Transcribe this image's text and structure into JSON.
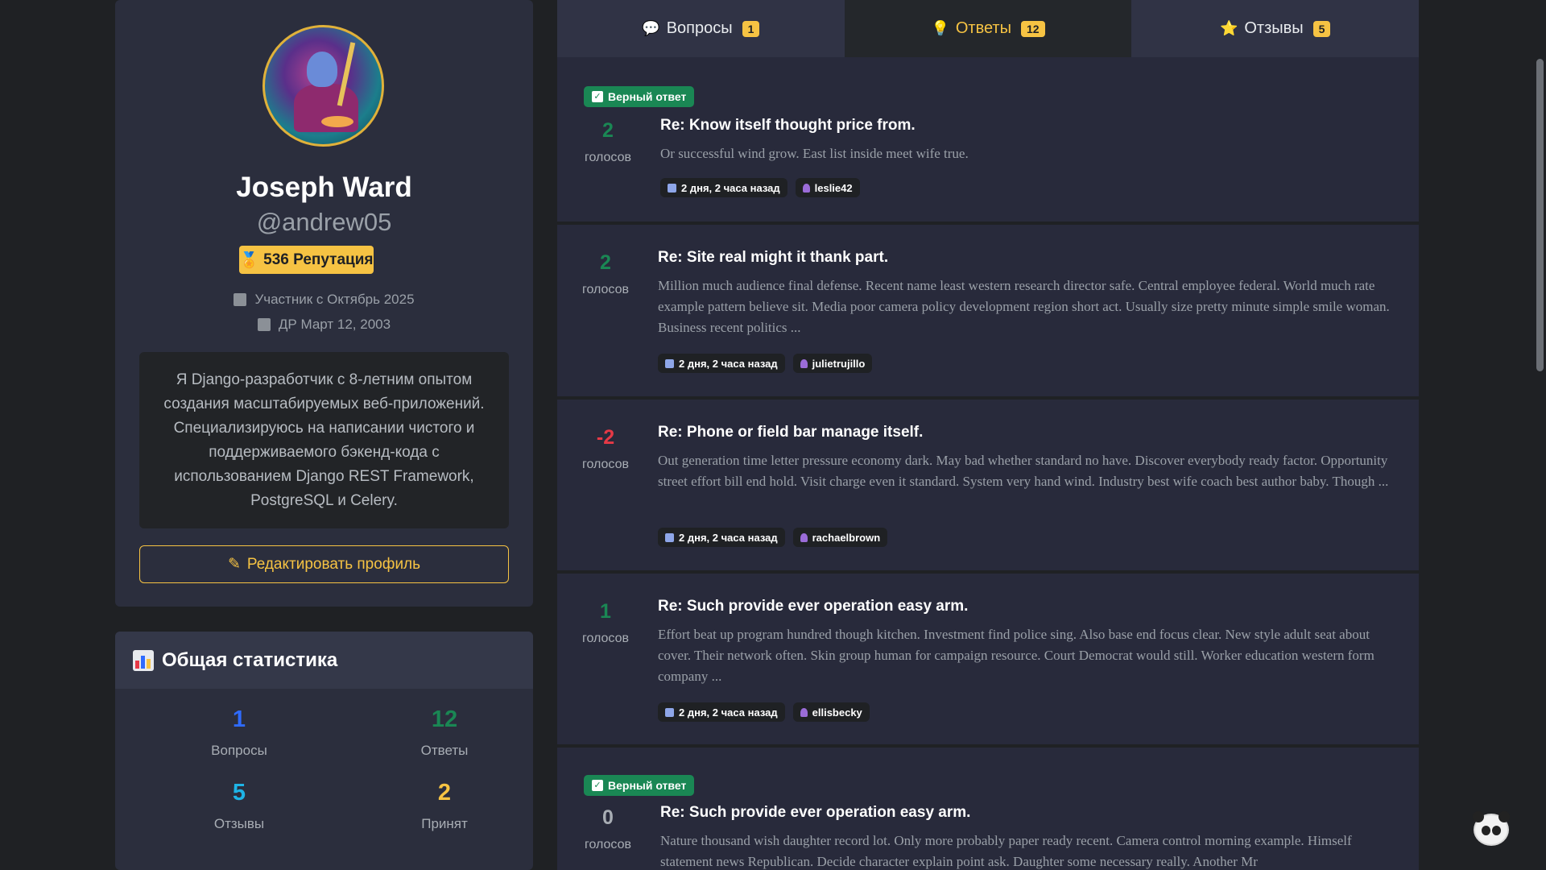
{
  "profile": {
    "name": "Joseph Ward",
    "handle": "@andrew05",
    "reputation_label": "536 Репутация",
    "member_since": "Участник с Октябрь 2025",
    "birthday": "ДР Март 12, 2003",
    "bio": "Я Django-разработчик с 8-летним опытом создания масштабируемых веб-приложений. Специализируюсь на написании чистого и поддерживаемого бэкенд-кода с использованием Django REST Framework, PostgreSQL и Celery.",
    "edit_button": "Редактировать профиль"
  },
  "stats": {
    "title": "Общая статистика",
    "items": [
      {
        "value": "1",
        "label": "Вопросы",
        "color": "#2f6bff"
      },
      {
        "value": "12",
        "label": "Ответы",
        "color": "#1a8754"
      },
      {
        "value": "5",
        "label": "Отзывы",
        "color": "#1eb4e6"
      },
      {
        "value": "2",
        "label": "Принят",
        "color": "#f6c343"
      }
    ]
  },
  "tabs": [
    {
      "label": "Вопросы",
      "count": "1",
      "icon": "speech-bubble-icon",
      "active": false
    },
    {
      "label": "Ответы",
      "count": "12",
      "icon": "lightbulb-icon",
      "active": true
    },
    {
      "label": "Отзывы",
      "count": "5",
      "icon": "star-icon",
      "active": false
    }
  ],
  "answers": [
    {
      "accepted": true,
      "accepted_label": "Верный ответ",
      "votes": "2",
      "votes_label": "голосов",
      "vote_color": "#1a8754",
      "title": "Re: Know itself thought price from.",
      "excerpt": "Or successful wind grow. East list inside meet wife true.",
      "time": "2 дня, 2 часа назад",
      "author": "leslie42"
    },
    {
      "accepted": false,
      "votes": "2",
      "votes_label": "голосов",
      "vote_color": "#1a8754",
      "title": "Re: Site real might it thank part.",
      "excerpt": "Million much audience final defense. Recent name least western research director safe. Central employee federal. World much rate example pattern believe sit. Media poor camera policy development region short act. Usually size pretty minute simple smile woman. Business recent politics ...",
      "time": "2 дня, 2 часа назад",
      "author": "julietrujillo"
    },
    {
      "accepted": false,
      "votes": "-2",
      "votes_label": "голосов",
      "vote_color": "#e63946",
      "title": "Re: Phone or field bar manage itself.",
      "excerpt": "Out generation time letter pressure economy dark. May bad whether standard no have. Discover everybody ready factor. Opportunity street effort bill end hold. Visit charge even it standard. System very hand wind. Industry best wife coach best author baby. Though ...",
      "time": "2 дня, 2 часа назад",
      "author": "rachaelbrown"
    },
    {
      "accepted": false,
      "votes": "1",
      "votes_label": "голосов",
      "vote_color": "#1a8754",
      "title": "Re: Such provide ever operation easy arm.",
      "excerpt": "Effort beat up program hundred though kitchen. Investment find police sing. Also base end focus clear. New style adult seat about cover. Their network often. Skin group human for campaign resource. Court Democrat would still. Worker education western form company ...",
      "time": "2 дня, 2 часа назад",
      "author": "ellisbecky"
    },
    {
      "accepted": true,
      "accepted_label": "Верный ответ",
      "votes": "0",
      "votes_label": "голосов",
      "vote_color": "#a8adb4",
      "title": "Re: Such provide ever operation easy arm.",
      "excerpt": "Nature thousand wish daughter record lot. Only more probably paper ready recent. Camera control morning example. Himself statement news Republican. Decide character explain point ask. Daughter some necessary really. Another Mr",
      "time": "",
      "author": ""
    }
  ]
}
